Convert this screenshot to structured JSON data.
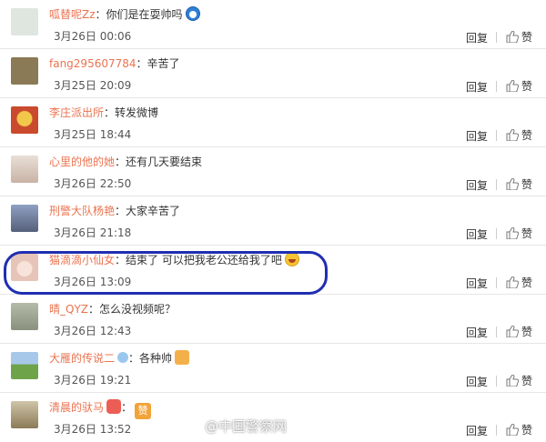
{
  "actions": {
    "reply": "回复",
    "like": "赞"
  },
  "comments": [
    {
      "username": "呱替呢Zz",
      "text": "你们是在耍帅吗",
      "emoji": "doraemon-emoji",
      "time": "3月26日 00:06"
    },
    {
      "username": "fang295607784",
      "text": "辛苦了",
      "time": "3月25日 20:09"
    },
    {
      "username": "李庄派出所",
      "text": "转发微博",
      "time": "3月25日 18:44"
    },
    {
      "username": "心里的他的她",
      "text": "还有几天要结束",
      "time": "3月26日 22:50"
    },
    {
      "username": "刑警大队杨艳",
      "text": "大家辛苦了",
      "time": "3月26日 21:18"
    },
    {
      "username": "猫滴滴小仙女",
      "text": "结束了 可以把我老公还给我了吧",
      "emoji": "laughing-tears-emoji",
      "time": "3月26日 13:09"
    },
    {
      "username": "晴_QYZ",
      "text": "怎么没视频呢？",
      "time": "3月26日 12:43"
    },
    {
      "username": "大雁的传说二",
      "text": "各种帅",
      "emoji": "thumbs-up-emoji",
      "time": "3月26日 19:21"
    },
    {
      "username": "清晨的驮马",
      "text": "",
      "emoji": "like-badge-emoji",
      "time": "3月26日 13:52"
    }
  ],
  "watermark": "@中国警察网",
  "colors": {
    "username": "#eb7350",
    "text": "#333333",
    "time": "#555555",
    "highlight": "#1f2fb1"
  },
  "avatar_colors": [
    "#cfd6cf",
    "#8a7a55",
    "#c94a2c",
    "#d8c6b8",
    "#7f8fb3",
    "#e8d7d0",
    "#9aa38f",
    "#6fa34a",
    "#b9a27a"
  ]
}
